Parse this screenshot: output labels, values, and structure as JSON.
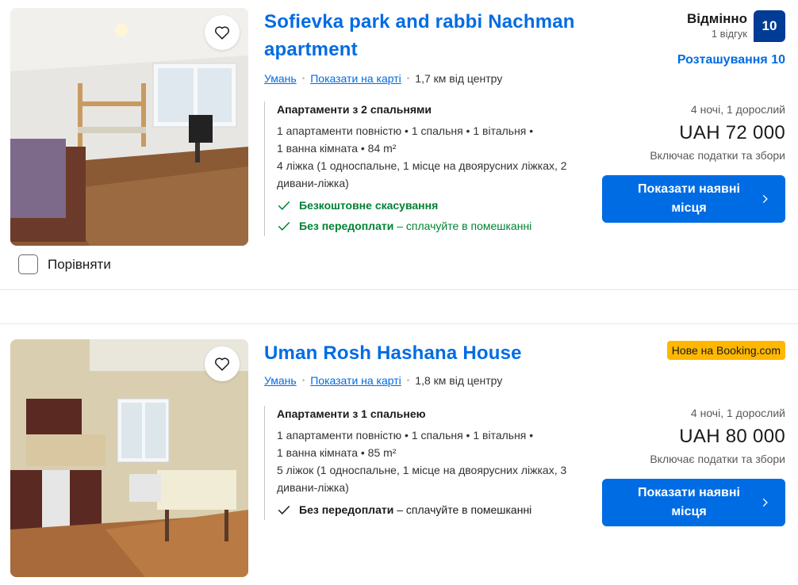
{
  "compare_label": "Порівняти",
  "listings": [
    {
      "title": "Sofievka park and rabbi Nachman apartment",
      "city": "Умань",
      "map_link": "Показати на карті",
      "distance": "1,7 км від центру",
      "room_type": "Апартаменти з 2 спальнями",
      "details_line1": "1 апартаменти повністю • 1 спальня • 1 вітальня •",
      "details_line2": "1 ванна кімната • 84 m²",
      "beds": "4 ліжка (1 односпальне, 1 місце на двоярусних ліжках, 2 дивани-ліжка)",
      "perk1": "Безкоштовне скасування",
      "perk2_bold": "Без передоплати",
      "perk2_rest": " – сплачуйте в помешканні",
      "review_word": "Відмінно",
      "review_count": "1 відгук",
      "review_score": "10",
      "location_score": "Розташування 10",
      "stay": "4 ночі, 1 дорослий",
      "price": "UAH 72 000",
      "taxes": "Включає податки та збори",
      "cta": "Показати наявні місця"
    },
    {
      "title": "Uman Rosh Hashana House",
      "new_badge": "Нове на Booking.com",
      "city": "Умань",
      "map_link": "Показати на карті",
      "distance": "1,8 км від центру",
      "room_type": "Апартаменти з 1 спальнею",
      "details_line1": "1 апартаменти повністю • 1 спальня • 1 вітальня •",
      "details_line2": "1 ванна кімната • 85 m²",
      "beds": "5 ліжок (1 односпальне, 1 місце на двоярусних ліжках, 3 дивани-ліжка)",
      "perk2_bold": "Без передоплати",
      "perk2_rest": " – сплачуйте в помешканні",
      "stay": "4 ночі, 1 дорослий",
      "price": "UAH 80 000",
      "taxes": "Включає податки та збори",
      "cta": "Показати наявні місця"
    }
  ],
  "colors": {
    "link": "#006ce4",
    "badge": "#003b95",
    "green": "#008234",
    "new_badge": "#ffb700"
  }
}
